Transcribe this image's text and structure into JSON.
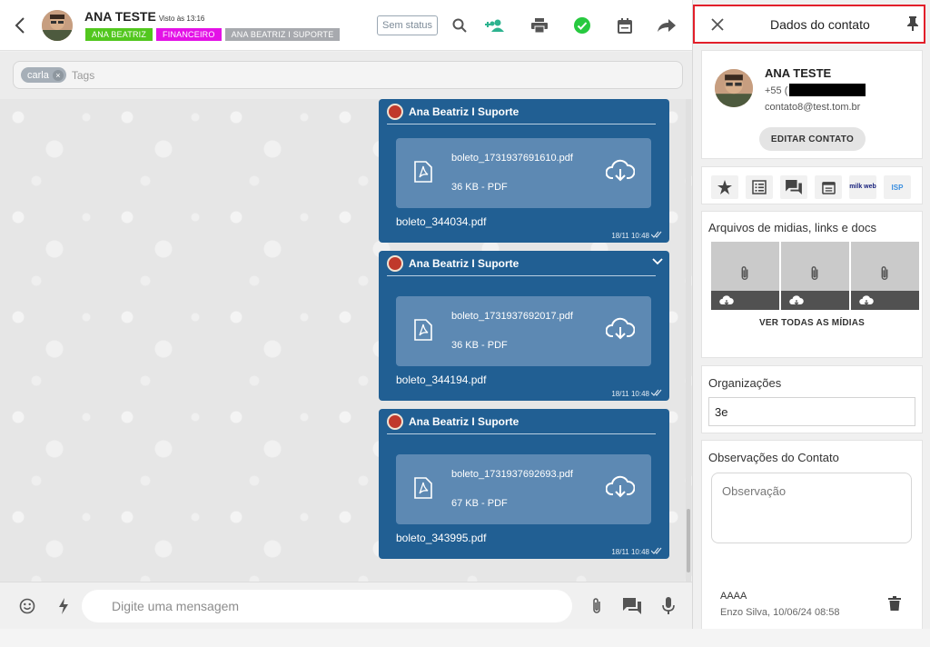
{
  "chat": {
    "contact_name": "ANA TESTE",
    "last_seen": "Visto às 13:16",
    "tags": [
      {
        "label": "ANA BEATRIZ",
        "color": "#52c71e"
      },
      {
        "label": "FINANCEIRO",
        "color": "#e312e6"
      },
      {
        "label": "ANA BEATRIZ I SUPORTE",
        "color": "#a7a9ae"
      }
    ],
    "status_label": "Sem status",
    "icons": [
      "back-arrow-icon",
      "search-icon",
      "group-add-icon",
      "print-icon",
      "check-circle-icon",
      "calendar-icon",
      "forward-icon"
    ],
    "tag_chip": "carla",
    "tag_placeholder": "Tags",
    "accent_color": "#215f93",
    "messages": [
      {
        "sender": "Ana Beatriz I Suporte",
        "file_name": "boleto_1731937691610.pdf",
        "file_size": "36 KB - PDF",
        "caption": "boleto_344034.pdf",
        "time": "18/11 10:48"
      },
      {
        "sender": "Ana Beatriz I Suporte",
        "file_name": "boleto_1731937692017.pdf",
        "file_size": "36 KB - PDF",
        "caption": "boleto_344194.pdf",
        "time": "18/11 10:48"
      },
      {
        "sender": "Ana Beatriz I Suporte",
        "file_name": "boleto_1731937692693.pdf",
        "file_size": "67 KB - PDF",
        "caption": "boleto_343995.pdf",
        "time": "18/11 10:48"
      }
    ],
    "composer_placeholder": "Digite uma mensagem"
  },
  "panel": {
    "title": "Dados do contato",
    "name": "ANA TESTE",
    "phone_prefix": "+55 (",
    "email": "contato8@test.tom.br",
    "edit_button": "EDITAR CONTATO",
    "action_labels": [
      "milk web",
      "ISP"
    ],
    "media_title": "Arquivos de midias, links e docs",
    "media_tiles": 3,
    "view_all": "VER TODAS AS MÍDIAS",
    "org_title": "Organizações",
    "org_value": "3e",
    "notes_title": "Observações do Contato",
    "notes_placeholder": "Observação",
    "note": {
      "text": "AAAA",
      "meta": "Enzo Silva, 10/06/24 08:58"
    }
  }
}
